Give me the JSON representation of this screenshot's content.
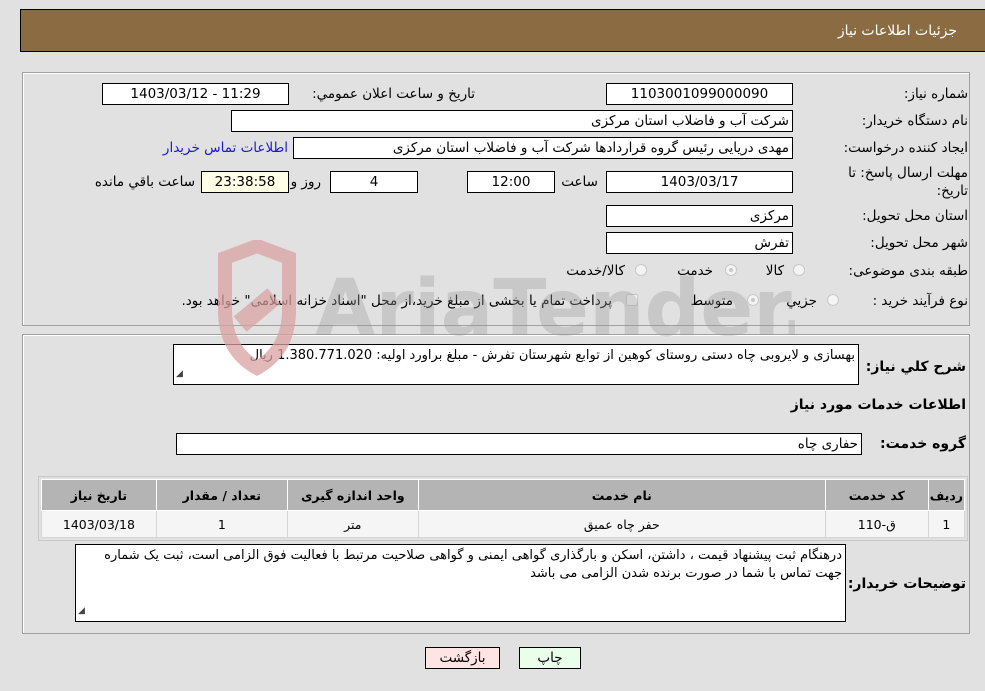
{
  "header": {
    "title": "جزئیات اطلاعات نیاز"
  },
  "form": {
    "need_number_label": "شماره نیاز:",
    "need_number": "1103001099000090",
    "announce_label": "تاریخ و ساعت اعلان عمومي:",
    "announce_value": "1403/03/12 - 11:29",
    "buyer_org_label": "نام دستگاه خریدار:",
    "buyer_org": "شرکت آب و فاضلاب استان مرکزی",
    "creator_label": "ایجاد کننده درخواست:",
    "creator": "مهدی دریایی رئیس گروه قراردادها شرکت آب و فاضلاب استان مرکزی",
    "contact_link": "اطلاعات تماس خریدار",
    "deadline_label": "مهلت ارسال پاسخ: تا تاریخ:",
    "deadline_date": "1403/03/17",
    "time_label": "ساعت",
    "deadline_time": "12:00",
    "days_value": "4",
    "days_label": "روز و",
    "remaining_time": "23:38:58",
    "remaining_label": "ساعت باقي مانده",
    "province_label": "استان محل تحویل:",
    "province": "مرکزی",
    "city_label": "شهر محل تحویل:",
    "city": "تفرش",
    "category_label": "طبقه بندی موضوعی:",
    "category_options": [
      {
        "label": "کالا",
        "checked": false
      },
      {
        "label": "خدمت",
        "checked": true
      },
      {
        "label": "کالا/خدمت",
        "checked": false
      }
    ],
    "process_label": "نوع فرآیند خرید :",
    "process_options": [
      {
        "label": "جزيي",
        "checked": false
      },
      {
        "label": "متوسط",
        "checked": true
      }
    ],
    "treasury_note": "پرداخت تمام یا بخشی از مبلغ خرید،از محل \"اسناد خزانه اسلامی\" خواهد بود."
  },
  "description": {
    "label": "شرح كلي نياز:",
    "text": "بهسازی و لایروبی چاه دستی روستای کوهین از توابع شهرستان تفرش - مبلغ براورد اولیه: 1.380.771.020 ریال"
  },
  "services": {
    "section_title": "اطلاعات خدمات مورد نیاز",
    "group_label": "گروه خدمت:",
    "group_value": "حفاری چاه",
    "columns": [
      "ردیف",
      "کد خدمت",
      "نام خدمت",
      "واحد اندازه گیری",
      "تعداد / مقدار",
      "تاریخ نیاز"
    ],
    "rows": [
      [
        "1",
        "ق-110",
        "حفر چاه عمیق",
        "متر",
        "1",
        "1403/03/18"
      ]
    ]
  },
  "buyer_notes": {
    "label": "توضیحات خریدار:",
    "text": "درهنگام ثبت پیشنهاد قیمت ، داشتن، اسکن و بارگذاری گواهی ایمنی و گواهی صلاحیت مرتبط با فعالیت فوق الزامی است، ثبت یک شماره جهت تماس با شما در صورت برنده شدن الزامی می باشد"
  },
  "buttons": {
    "print": "چاپ",
    "back": "بازگشت"
  },
  "watermark": {
    "text": "AriaTender.neT"
  },
  "colors": {
    "header_bg": "#8b6b42",
    "back_btn_bg": "#ffe4e4",
    "print_btn_bg": "#eaffea",
    "link": "#1a1ad6"
  }
}
